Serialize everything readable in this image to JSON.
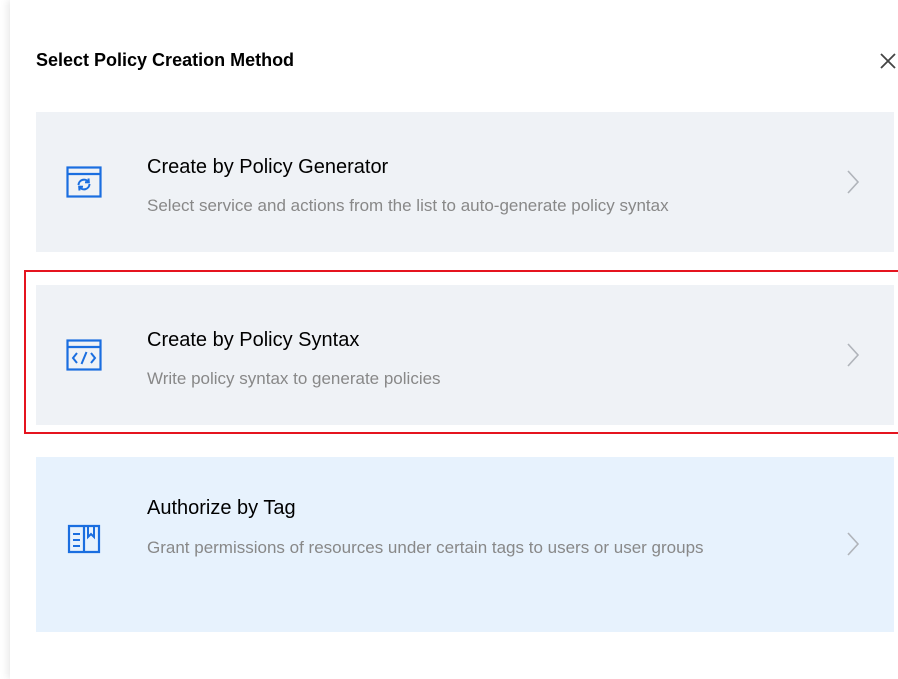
{
  "dialog": {
    "title": "Select Policy Creation Method",
    "close_icon": "close-icon"
  },
  "options": [
    {
      "title": "Create by Policy Generator",
      "description": "Select service and actions from the list to auto-generate policy syntax",
      "icon": "policy-generator-icon",
      "chevron_icon": "chevron-right-icon"
    },
    {
      "title": "Create by Policy Syntax",
      "description": "Write policy syntax to generate policies",
      "icon": "code-syntax-icon",
      "chevron_icon": "chevron-right-icon",
      "highlighted": true
    },
    {
      "title": "Authorize by Tag",
      "description": "Grant permissions of resources under certain tags to users or user groups",
      "icon": "tag-book-icon",
      "chevron_icon": "chevron-right-icon"
    }
  ],
  "colors": {
    "accent": "#1a6ee0",
    "option_bg": "#eff2f6",
    "option_bg_tag": "#e7f2fd",
    "highlight_border": "#e5141f",
    "description_text": "#888888"
  }
}
